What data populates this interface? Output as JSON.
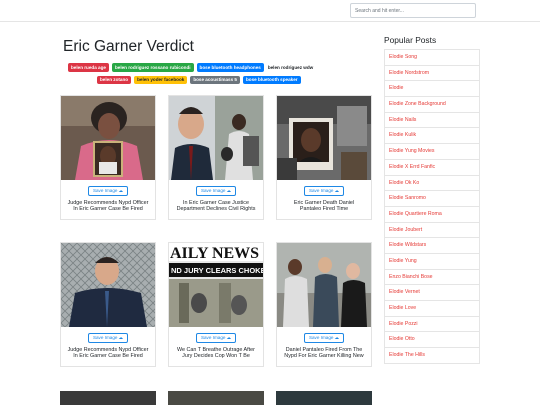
{
  "search": {
    "placeholder": "Search and hit enter..."
  },
  "page_title": "Eric Garner Verdict",
  "tags": [
    [
      {
        "label": "belen rueda age",
        "color": "#dc3545"
      },
      {
        "label": "belen rodriguez rossano rubicondi",
        "color": "#28a745"
      },
      {
        "label": "bose bluetooth headphones",
        "color": "#007bff"
      },
      {
        "label": "belen rodriguez wdw",
        "color": ""
      }
    ],
    [
      {
        "label": "belen zotano",
        "color": "#dc3545"
      },
      {
        "label": "belen yoder facebook",
        "color": "#ffc107"
      },
      {
        "label": "bose acoustimass 5",
        "color": "#6c757d"
      },
      {
        "label": "bose bluetooth speaker",
        "color": "#007bff"
      }
    ]
  ],
  "save_label": "Save Image",
  "cards": [
    {
      "caption": "Judge Recommends Nypd Officer In Eric Garner Case Be Fired"
    },
    {
      "caption": "In Eric Garner Case Justice Department Declines Civil Rights"
    },
    {
      "caption": "Eric Garner Death Daniel Pantaleo Fired Time"
    },
    {
      "caption": "Judge Recommends Nypd Officer In Eric Garner Case Be Fired"
    },
    {
      "caption": "We Can T Breathe Outrage After Jury Decides Cop Won T Be"
    },
    {
      "caption": "Daniel Pantaleo Fired From The Nypd For Eric Garner Killing New"
    }
  ],
  "newspaper": {
    "masthead": "AILY NEWS",
    "headline": "ND JURY CLEARS CHOKE C"
  },
  "sidebar": {
    "title": "Popular Posts",
    "items": [
      "Elodie Song",
      "Elodie Nordstrom",
      "Elodie",
      "Elodie Zone Background",
      "Elodie Nails",
      "Elodie Kulik",
      "Elodie Yung Movies",
      "Elodie X Errd Fanfic",
      "Elodie Ok Ko",
      "Elodie Sanromo",
      "Elodie Quartiere Roma",
      "Elodie Joubert",
      "Elodie Wildstars",
      "Elodie Yung",
      "Enzo Bianchi Bose",
      "Elodie Vernet",
      "Elodie Love",
      "Elodie Pozzi",
      "Elodie Otto",
      "Elodie The Hills"
    ]
  }
}
